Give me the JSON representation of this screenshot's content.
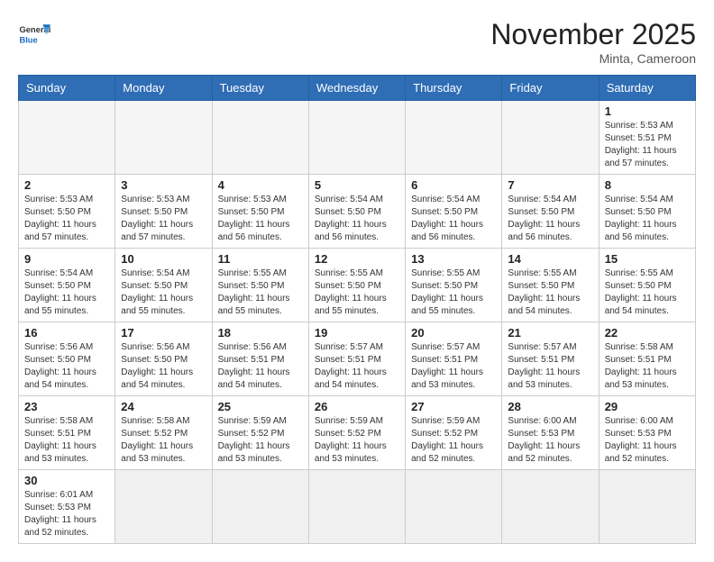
{
  "header": {
    "logo_general": "General",
    "logo_blue": "Blue",
    "month_title": "November 2025",
    "location": "Minta, Cameroon"
  },
  "weekdays": [
    "Sunday",
    "Monday",
    "Tuesday",
    "Wednesday",
    "Thursday",
    "Friday",
    "Saturday"
  ],
  "weeks": [
    [
      {
        "day": null,
        "info": null
      },
      {
        "day": null,
        "info": null
      },
      {
        "day": null,
        "info": null
      },
      {
        "day": null,
        "info": null
      },
      {
        "day": null,
        "info": null
      },
      {
        "day": null,
        "info": null
      },
      {
        "day": "1",
        "info": "Sunrise: 5:53 AM\nSunset: 5:51 PM\nDaylight: 11 hours\nand 57 minutes."
      }
    ],
    [
      {
        "day": "2",
        "info": "Sunrise: 5:53 AM\nSunset: 5:50 PM\nDaylight: 11 hours\nand 57 minutes."
      },
      {
        "day": "3",
        "info": "Sunrise: 5:53 AM\nSunset: 5:50 PM\nDaylight: 11 hours\nand 57 minutes."
      },
      {
        "day": "4",
        "info": "Sunrise: 5:53 AM\nSunset: 5:50 PM\nDaylight: 11 hours\nand 56 minutes."
      },
      {
        "day": "5",
        "info": "Sunrise: 5:54 AM\nSunset: 5:50 PM\nDaylight: 11 hours\nand 56 minutes."
      },
      {
        "day": "6",
        "info": "Sunrise: 5:54 AM\nSunset: 5:50 PM\nDaylight: 11 hours\nand 56 minutes."
      },
      {
        "day": "7",
        "info": "Sunrise: 5:54 AM\nSunset: 5:50 PM\nDaylight: 11 hours\nand 56 minutes."
      },
      {
        "day": "8",
        "info": "Sunrise: 5:54 AM\nSunset: 5:50 PM\nDaylight: 11 hours\nand 56 minutes."
      }
    ],
    [
      {
        "day": "9",
        "info": "Sunrise: 5:54 AM\nSunset: 5:50 PM\nDaylight: 11 hours\nand 55 minutes."
      },
      {
        "day": "10",
        "info": "Sunrise: 5:54 AM\nSunset: 5:50 PM\nDaylight: 11 hours\nand 55 minutes."
      },
      {
        "day": "11",
        "info": "Sunrise: 5:55 AM\nSunset: 5:50 PM\nDaylight: 11 hours\nand 55 minutes."
      },
      {
        "day": "12",
        "info": "Sunrise: 5:55 AM\nSunset: 5:50 PM\nDaylight: 11 hours\nand 55 minutes."
      },
      {
        "day": "13",
        "info": "Sunrise: 5:55 AM\nSunset: 5:50 PM\nDaylight: 11 hours\nand 55 minutes."
      },
      {
        "day": "14",
        "info": "Sunrise: 5:55 AM\nSunset: 5:50 PM\nDaylight: 11 hours\nand 54 minutes."
      },
      {
        "day": "15",
        "info": "Sunrise: 5:55 AM\nSunset: 5:50 PM\nDaylight: 11 hours\nand 54 minutes."
      }
    ],
    [
      {
        "day": "16",
        "info": "Sunrise: 5:56 AM\nSunset: 5:50 PM\nDaylight: 11 hours\nand 54 minutes."
      },
      {
        "day": "17",
        "info": "Sunrise: 5:56 AM\nSunset: 5:50 PM\nDaylight: 11 hours\nand 54 minutes."
      },
      {
        "day": "18",
        "info": "Sunrise: 5:56 AM\nSunset: 5:51 PM\nDaylight: 11 hours\nand 54 minutes."
      },
      {
        "day": "19",
        "info": "Sunrise: 5:57 AM\nSunset: 5:51 PM\nDaylight: 11 hours\nand 54 minutes."
      },
      {
        "day": "20",
        "info": "Sunrise: 5:57 AM\nSunset: 5:51 PM\nDaylight: 11 hours\nand 53 minutes."
      },
      {
        "day": "21",
        "info": "Sunrise: 5:57 AM\nSunset: 5:51 PM\nDaylight: 11 hours\nand 53 minutes."
      },
      {
        "day": "22",
        "info": "Sunrise: 5:58 AM\nSunset: 5:51 PM\nDaylight: 11 hours\nand 53 minutes."
      }
    ],
    [
      {
        "day": "23",
        "info": "Sunrise: 5:58 AM\nSunset: 5:51 PM\nDaylight: 11 hours\nand 53 minutes."
      },
      {
        "day": "24",
        "info": "Sunrise: 5:58 AM\nSunset: 5:52 PM\nDaylight: 11 hours\nand 53 minutes."
      },
      {
        "day": "25",
        "info": "Sunrise: 5:59 AM\nSunset: 5:52 PM\nDaylight: 11 hours\nand 53 minutes."
      },
      {
        "day": "26",
        "info": "Sunrise: 5:59 AM\nSunset: 5:52 PM\nDaylight: 11 hours\nand 53 minutes."
      },
      {
        "day": "27",
        "info": "Sunrise: 5:59 AM\nSunset: 5:52 PM\nDaylight: 11 hours\nand 52 minutes."
      },
      {
        "day": "28",
        "info": "Sunrise: 6:00 AM\nSunset: 5:53 PM\nDaylight: 11 hours\nand 52 minutes."
      },
      {
        "day": "29",
        "info": "Sunrise: 6:00 AM\nSunset: 5:53 PM\nDaylight: 11 hours\nand 52 minutes."
      }
    ],
    [
      {
        "day": "30",
        "info": "Sunrise: 6:01 AM\nSunset: 5:53 PM\nDaylight: 11 hours\nand 52 minutes."
      },
      {
        "day": null,
        "info": null
      },
      {
        "day": null,
        "info": null
      },
      {
        "day": null,
        "info": null
      },
      {
        "day": null,
        "info": null
      },
      {
        "day": null,
        "info": null
      },
      {
        "day": null,
        "info": null
      }
    ]
  ]
}
